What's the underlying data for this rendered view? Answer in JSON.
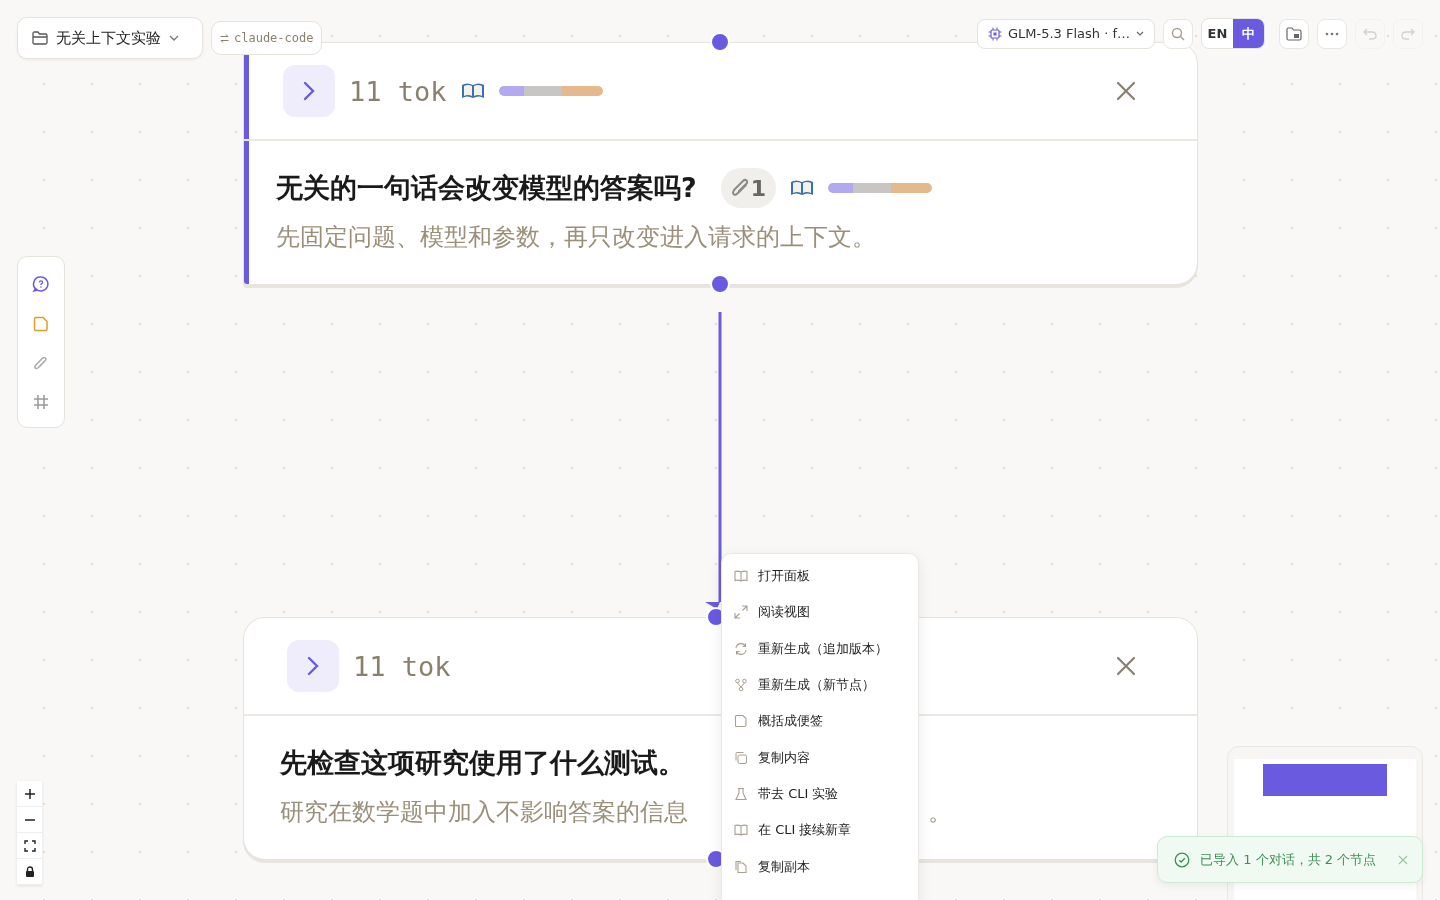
{
  "project": {
    "name": "无关上下文实验"
  },
  "source_tag": {
    "label": "claude-code"
  },
  "model": {
    "label": "GLM-5.3 Flash · f…"
  },
  "language": [
    {
      "label": "EN",
      "selected": false
    },
    {
      "label": "中",
      "selected": true
    }
  ],
  "history": {
    "undo_disabled": true,
    "redo_disabled": true
  },
  "nodes": [
    {
      "tokens": "11 tok",
      "selected": true,
      "context_bar": true,
      "title": "无关的一句话会改变模型的答案吗?",
      "attachments": "1",
      "subtitle": "先固定问题、模型和参数，再只改变进入请求的上下文。"
    },
    {
      "tokens": "11 tok",
      "selected": false,
      "context_bar": false,
      "title": "先检查这项研究使用了什么测试。",
      "subtitle": "研究在数学题中加入不影响答案的信息",
      "subtitle_tail": "。"
    }
  ],
  "context_menu": {
    "items": [
      "打开面板",
      "阅读视图",
      "重新生成（追加版本）",
      "重新生成（新节点）",
      "概括成便签",
      "复制内容",
      "带去 CLI 实验",
      "在 CLI 接续新章",
      "复制副本"
    ]
  },
  "toast": {
    "message": "已导入 1 个对话，共 2 个节点"
  }
}
